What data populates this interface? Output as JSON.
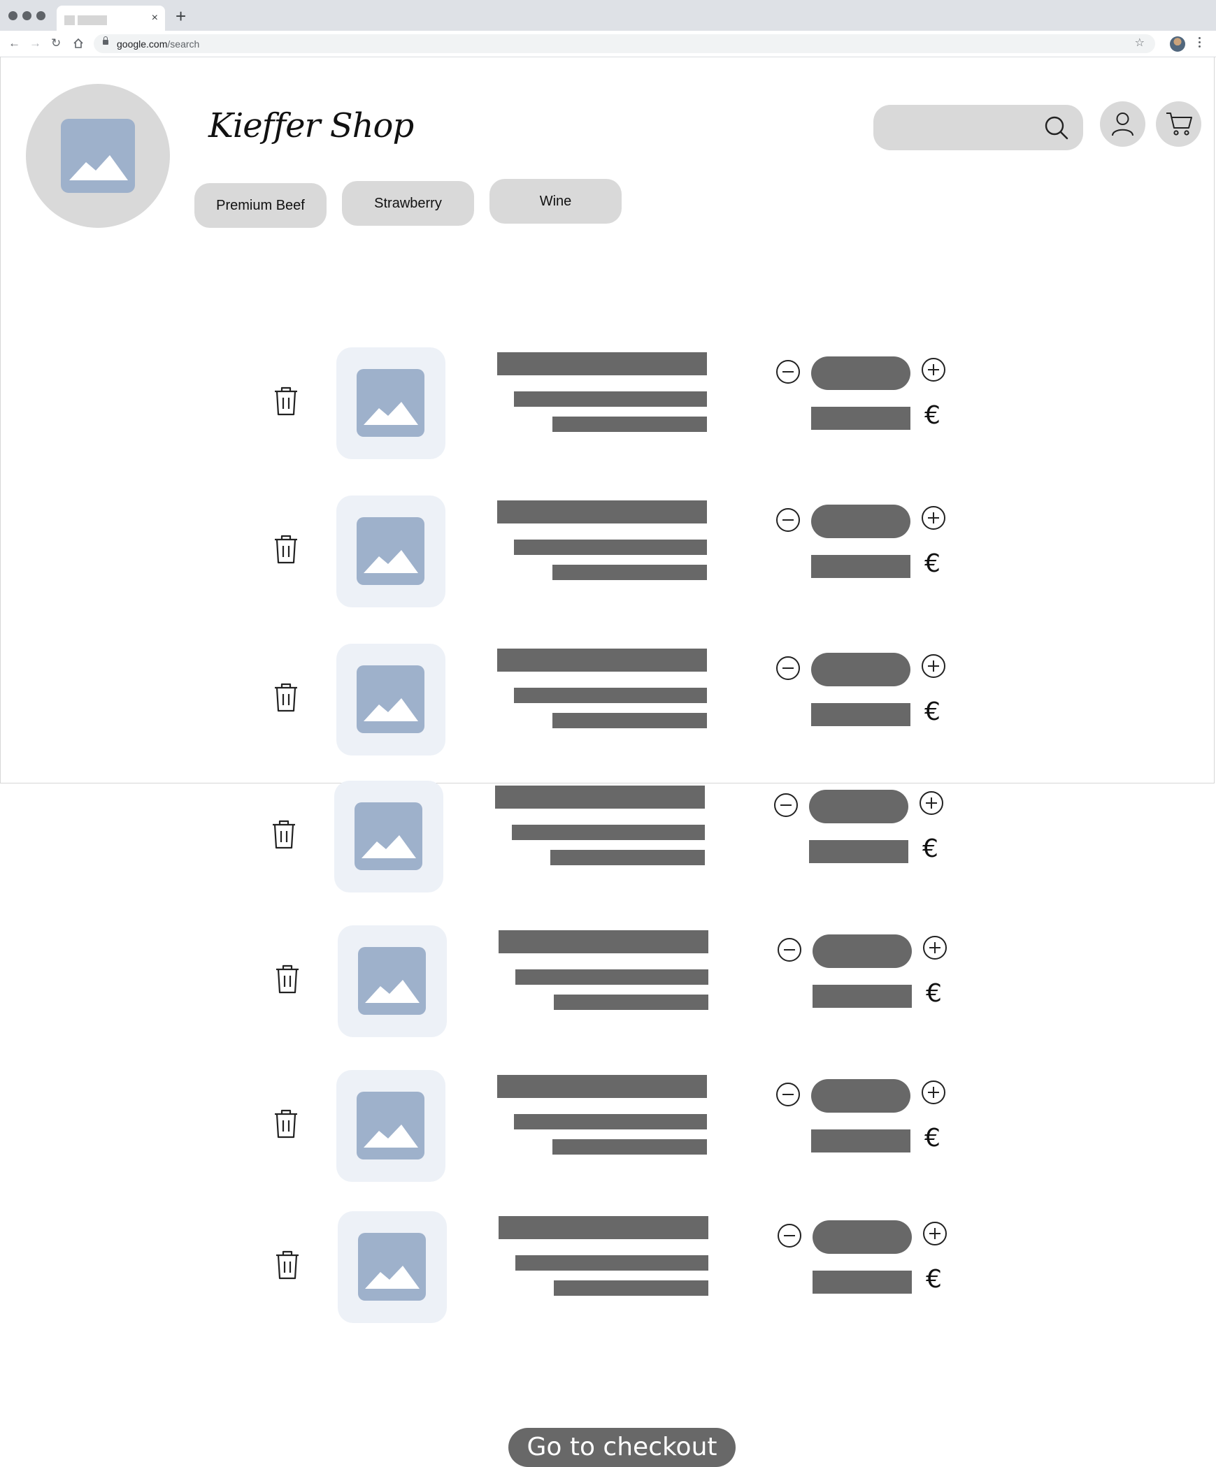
{
  "browser": {
    "tab_close_glyph": "×",
    "new_tab_glyph": "+",
    "url_domain": "google.com",
    "url_path": "/search",
    "icons": [
      "back-icon",
      "forward-icon",
      "reload-icon",
      "home-icon",
      "lock-icon",
      "star-icon",
      "profile-avatar",
      "menu-icon"
    ]
  },
  "header": {
    "shop_name": "Kieffer Shop",
    "categories": [
      "Premium Beef",
      "Strawberry",
      "Wine"
    ],
    "icons": [
      "logo-image-icon",
      "search-icon",
      "user-icon",
      "cart-icon"
    ]
  },
  "cart": {
    "currency_symbol": "€",
    "item_count": 7,
    "icons": [
      "trash-icon",
      "product-image-icon",
      "minus-icon",
      "plus-icon"
    ]
  },
  "checkout": {
    "label": "Go to checkout"
  },
  "colors": {
    "placeholder_fill": "#d9d9d9",
    "text_bar": "#686868",
    "thumb_bg": "#edf1f7",
    "image_icon": "#9eb1cb"
  }
}
